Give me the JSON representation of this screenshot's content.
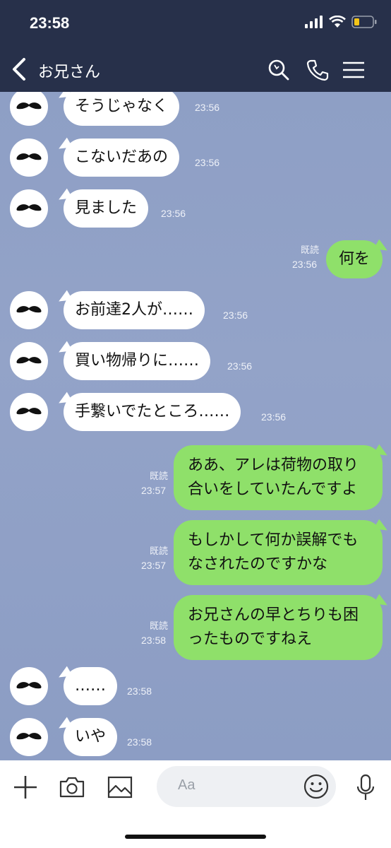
{
  "status": {
    "time": "23:58"
  },
  "header": {
    "title": "お兄さん"
  },
  "messages": [
    {
      "side": "left",
      "text": "そうじゃなく",
      "time": "23:56"
    },
    {
      "side": "left",
      "text": "こないだあの",
      "time": "23:56"
    },
    {
      "side": "left",
      "text": "見ました",
      "time": "23:56"
    },
    {
      "side": "right",
      "text": "何を",
      "read": "既読",
      "time": "23:56"
    },
    {
      "side": "left",
      "text": "お前達2人が……",
      "time": "23:56"
    },
    {
      "side": "left",
      "text": "買い物帰りに……",
      "time": "23:56"
    },
    {
      "side": "left",
      "text": "手繋いでたところ……",
      "time": "23:56"
    },
    {
      "side": "right",
      "line1": "ああ、アレは荷物の取り",
      "line2": "合いをしていたんですよ",
      "read": "既読",
      "time": "23:57"
    },
    {
      "side": "right",
      "line1": "もしかして何か誤解でも",
      "line2": "なされたのですかな",
      "read": "既読",
      "time": "23:57"
    },
    {
      "side": "right",
      "line1": "お兄さんの早とちりも困",
      "line2": "ったものですねえ",
      "read": "既読",
      "time": "23:58"
    },
    {
      "side": "left",
      "text": "……",
      "time": "23:58"
    },
    {
      "side": "left",
      "text": "いや",
      "time": "23:58"
    }
  ],
  "input": {
    "placeholder": "Aa"
  },
  "icons": {
    "status": [
      "signal-icon",
      "wifi-icon",
      "battery-icon"
    ],
    "header": [
      "back-icon",
      "search-icon",
      "phone-icon",
      "menu-icon"
    ],
    "input": [
      "plus-icon",
      "camera-icon",
      "image-icon",
      "emoji-icon",
      "mic-icon"
    ]
  },
  "colors": {
    "header_bg": "#27304a",
    "chat_bg": "#8fa0c6",
    "my_bubble": "#8fe06a",
    "their_bubble": "#ffffff"
  }
}
